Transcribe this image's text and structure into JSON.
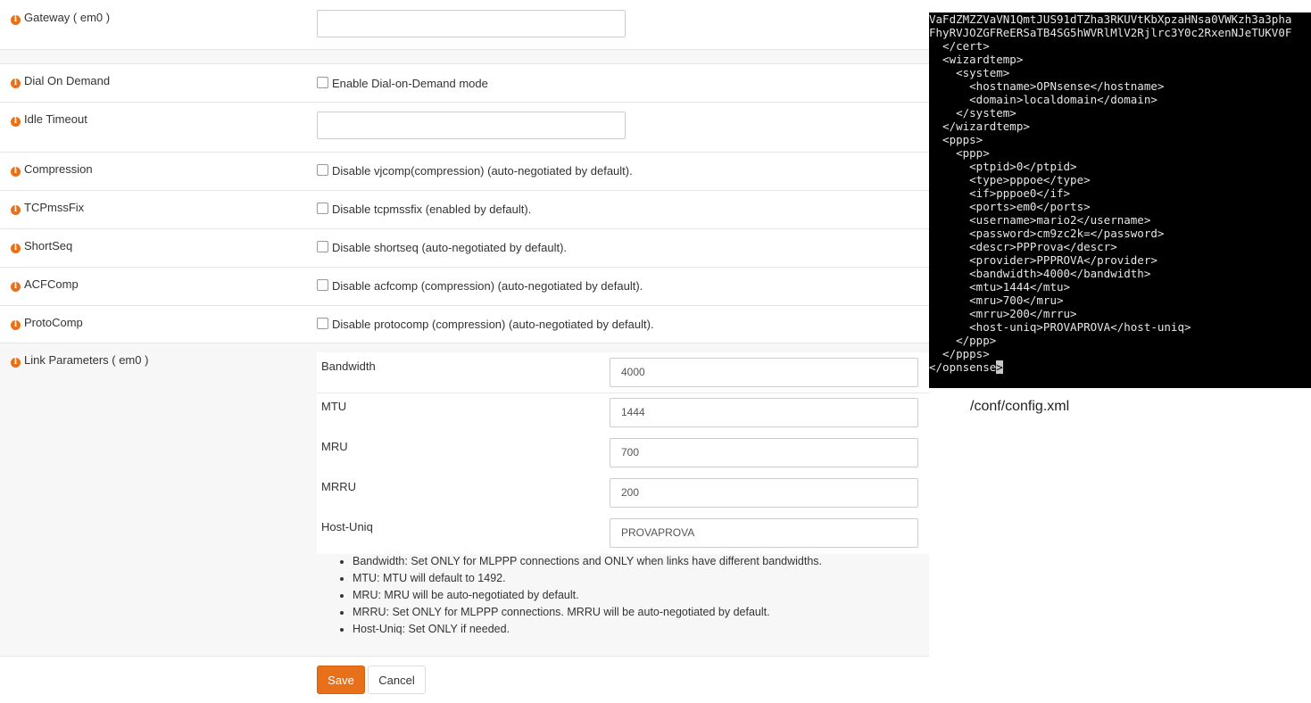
{
  "form": {
    "gateway": {
      "label": "Gateway ( em0 )",
      "value": ""
    },
    "dial_on_demand": {
      "label": "Dial On Demand",
      "checkbox_text": "Enable Dial-on-Demand mode"
    },
    "idle_timeout": {
      "label": "Idle Timeout",
      "value": ""
    },
    "compression": {
      "label": "Compression",
      "checkbox_text": "Disable vjcomp(compression) (auto-negotiated by default)."
    },
    "tcpmssfix": {
      "label": "TCPmssFix",
      "checkbox_text": "Disable tcpmssfix (enabled by default)."
    },
    "shortseq": {
      "label": "ShortSeq",
      "checkbox_text": "Disable shortseq (auto-negotiated by default)."
    },
    "acfcomp": {
      "label": "ACFComp",
      "checkbox_text": "Disable acfcomp (compression) (auto-negotiated by default)."
    },
    "protocomp": {
      "label": "ProtoComp",
      "checkbox_text": "Disable protocomp (compression) (auto-negotiated by default)."
    },
    "link_parameters": {
      "label": "Link Parameters ( em0 )",
      "rows": [
        {
          "name": "Bandwidth",
          "value": "4000"
        },
        {
          "name": "MTU",
          "value": "1444"
        },
        {
          "name": "MRU",
          "value": "700"
        },
        {
          "name": "MRRU",
          "value": "200"
        },
        {
          "name": "Host-Uniq",
          "value": "PROVAPROVA"
        }
      ],
      "help": [
        "Bandwidth: Set ONLY for MLPPP connections and ONLY when links have different bandwidths.",
        "MTU: MTU will default to 1492.",
        "MRU: MRU will be auto-negotiated by default.",
        "MRRU: Set ONLY for MLPPP connections. MRRU will be auto-negotiated by default.",
        "Host-Uniq: Set ONLY if needed."
      ]
    },
    "buttons": {
      "save": "Save",
      "cancel": "Cancel"
    },
    "accent_color": "#e8701a"
  },
  "terminal": {
    "lines": [
      "VaFdZMZZVaVN1QmtJUS91dTZha3RKUVtKbXpzaHNsa0VWKzh3a3pha",
      "FhyRVJOZGFReERSaTB4SG5hWVRlMlV2Rjlrc3Y0c2RxenNJeTUKV0F",
      "  </cert>",
      "  <wizardtemp>",
      "    <system>",
      "      <hostname>OPNsense</hostname>",
      "      <domain>localdomain</domain>",
      "    </system>",
      "  </wizardtemp>",
      "  <ppps>",
      "    <ppp>",
      "      <ptpid>0</ptpid>",
      "      <type>pppoe</type>",
      "      <if>pppoe0</if>",
      "      <ports>em0</ports>",
      "      <username>mario2</username>",
      "      <password>cm9zc2k=</password>",
      "      <descr>PPProva</descr>",
      "      <provider>PPPROVA</provider>",
      "      <bandwidth>4000</bandwidth>",
      "      <mtu>1444</mtu>",
      "      <mru>700</mru>",
      "      <mrru>200</mrru>",
      "      <host-uniq>PROVAPROVA</host-uniq>",
      "    </ppp>",
      "  </ppps>",
      "</opnsense"
    ],
    "cursor_char": ">"
  },
  "caption": "/conf/config.xml"
}
